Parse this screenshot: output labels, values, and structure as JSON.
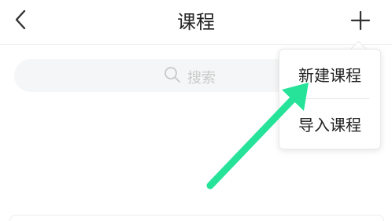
{
  "header": {
    "title": "课程",
    "back_icon": "chevron-left-icon",
    "add_icon": "plus-icon"
  },
  "search": {
    "placeholder": "搜索",
    "icon": "search-icon"
  },
  "menu": {
    "items": [
      {
        "label": "新建课程"
      },
      {
        "label": "导入课程"
      }
    ]
  },
  "annotation": {
    "arrow_color": "#27e39a"
  },
  "colors": {
    "text": "#222222",
    "placeholder": "#c9c9c9",
    "search_bg": "#f5f6f7"
  }
}
